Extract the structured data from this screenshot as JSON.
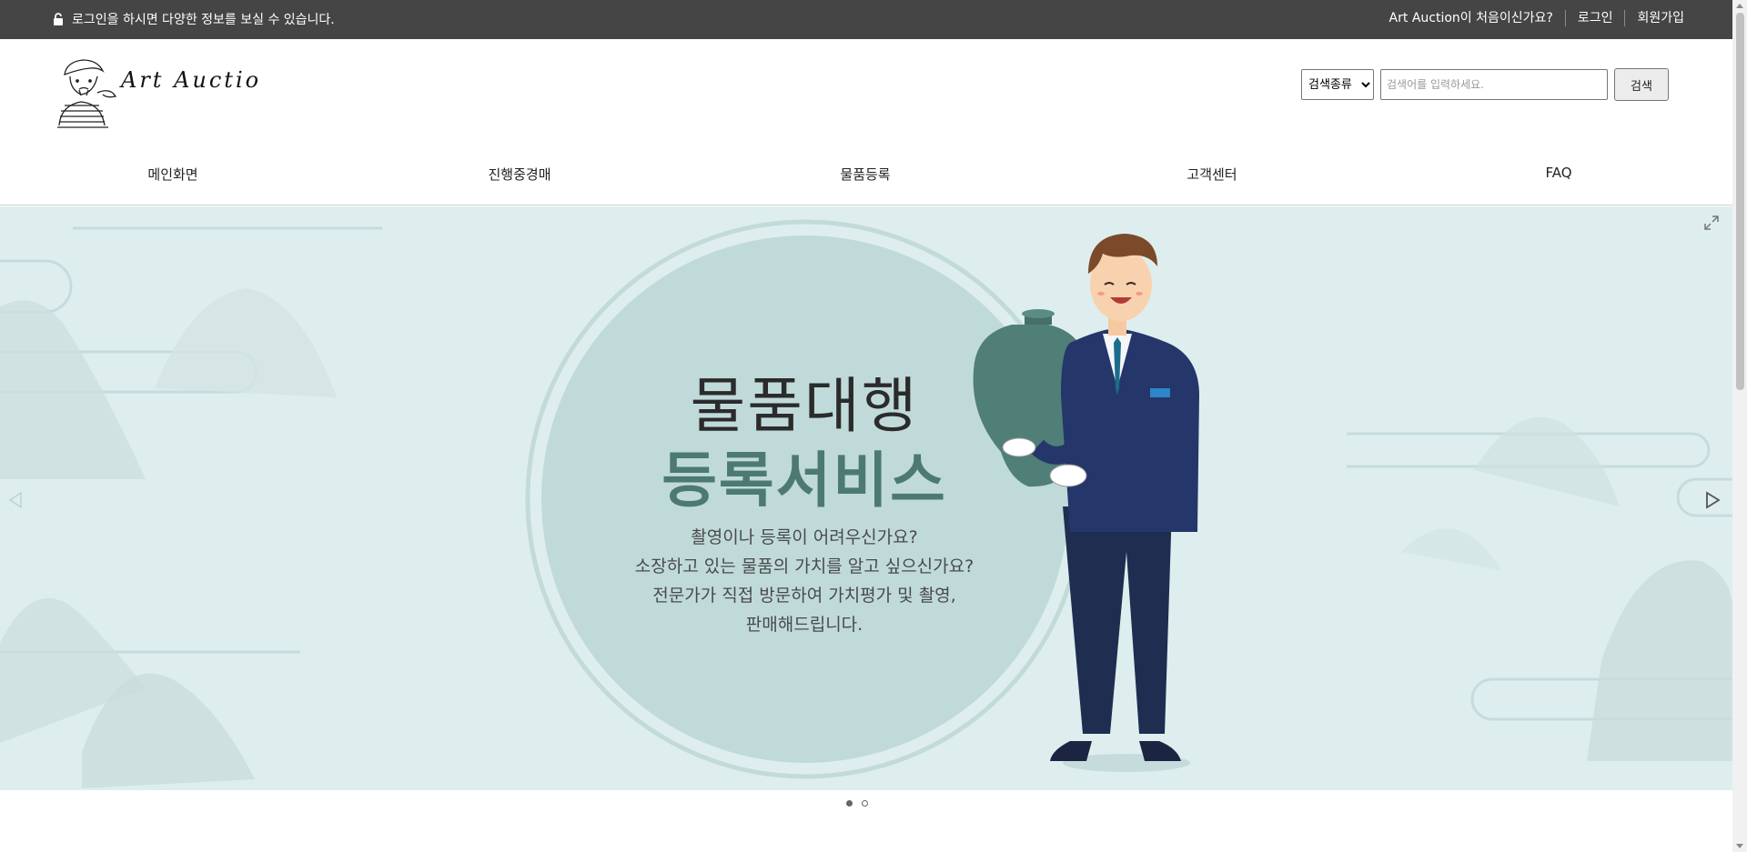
{
  "topbar": {
    "notice": "로그인을 하시면 다양한 정보를 보실 수 있습니다.",
    "first_time": "Art Auction이 처음이신가요?",
    "login": "로그인",
    "signup": "회원가입"
  },
  "logo": {
    "text": "Art Auction"
  },
  "search": {
    "select_value": "검색종류",
    "placeholder": "검색어를 입력하세요.",
    "button_label": "검색"
  },
  "nav": {
    "items": [
      "메인화면",
      "진행중경매",
      "물품등록",
      "고객센터",
      "FAQ"
    ]
  },
  "banner": {
    "headline1": "물품대행",
    "headline2": "등록서비스",
    "desc1": "촬영이나  등록이 어려우신가요?",
    "desc2": "소장하고 있는 물품의 가치를 알고 싶으신가요?",
    "desc3": "전문가가 직접 방문하여 가치평가 및 촬영,",
    "desc4": "판매해드립니다.",
    "accent_color": "#4c7a72",
    "background_color": "#deeeee",
    "slide_count": 2,
    "active_slide": 1
  }
}
